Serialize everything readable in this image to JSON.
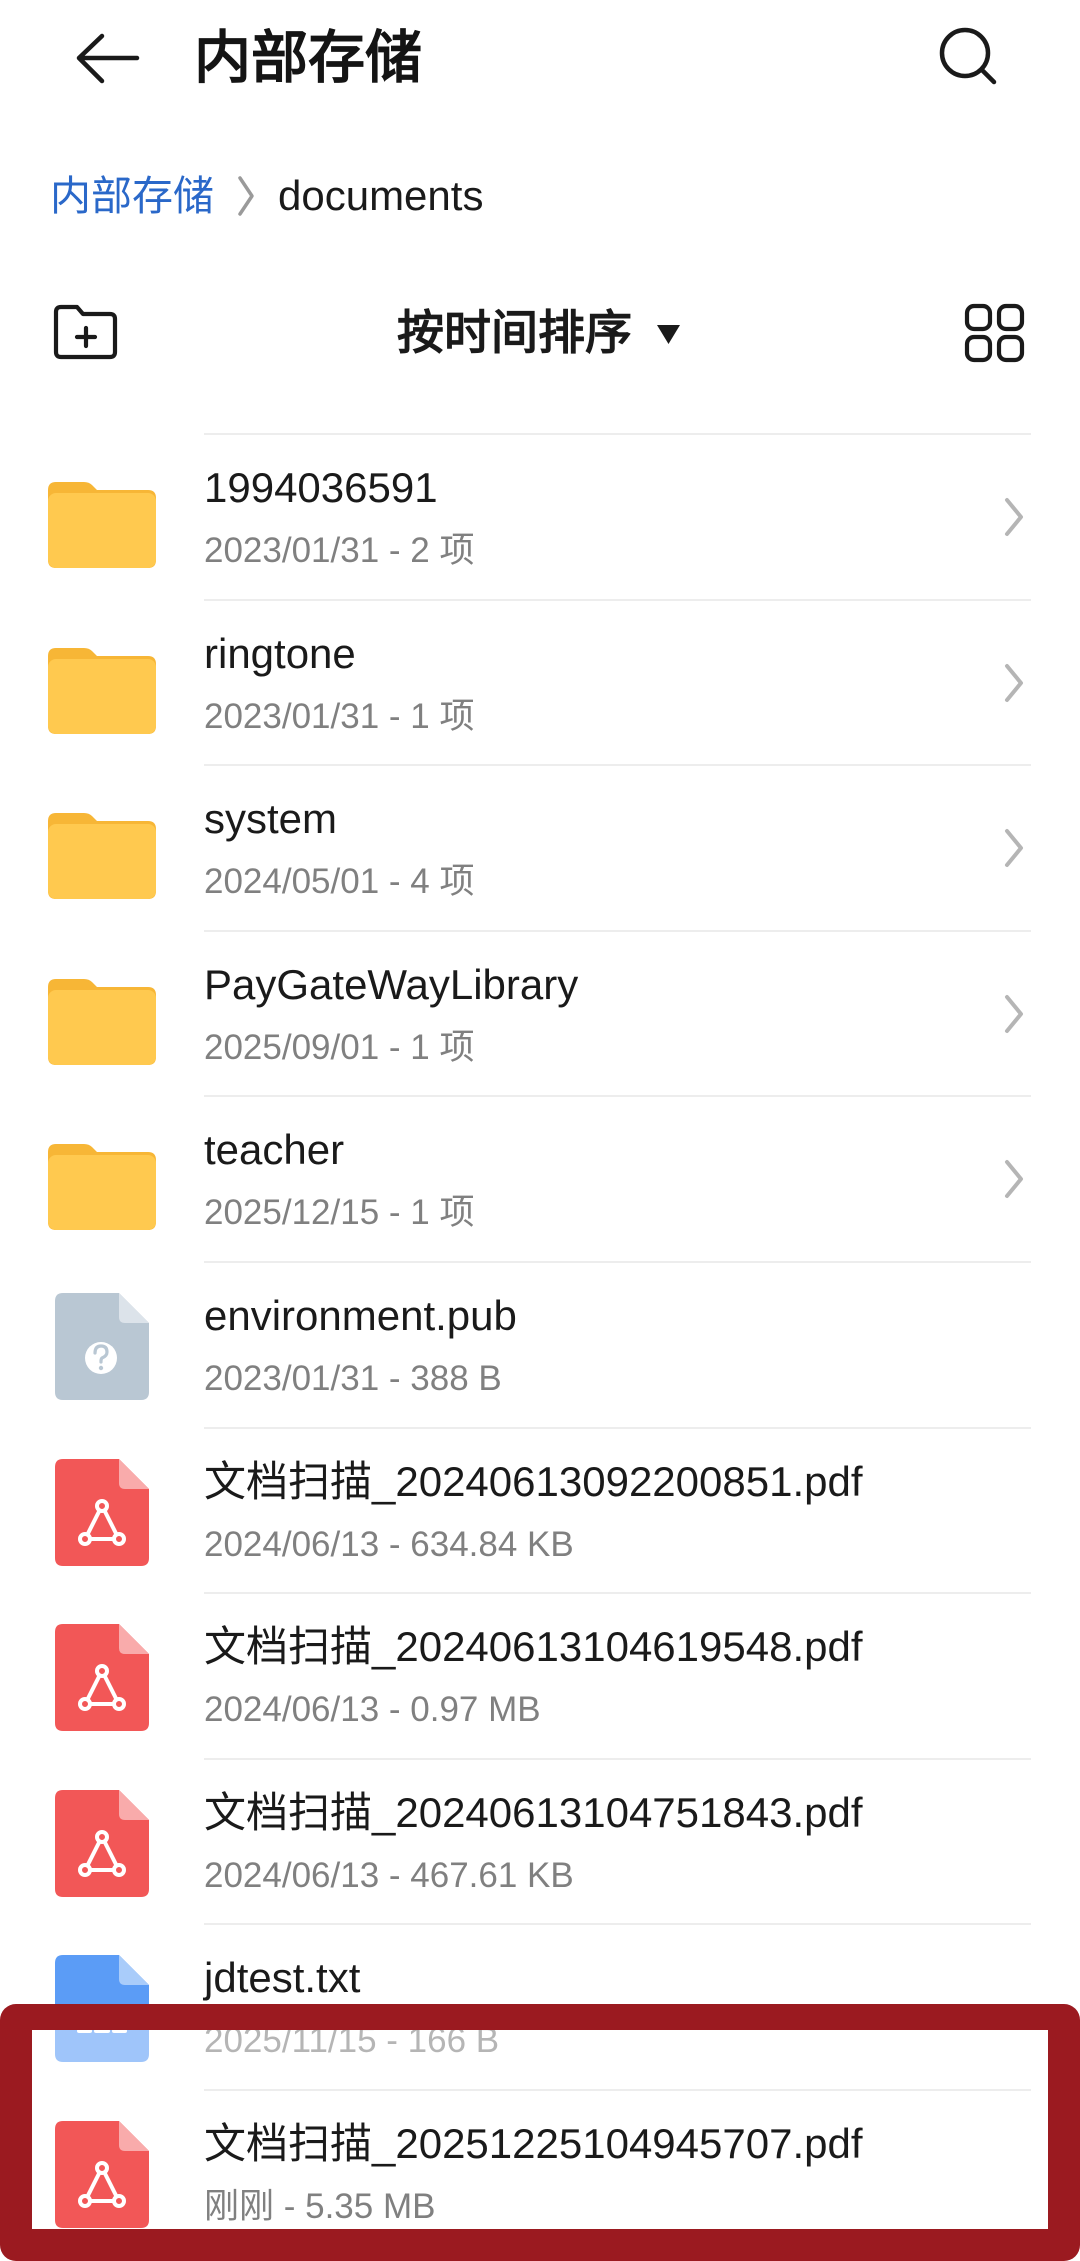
{
  "header": {
    "title": "内部存储",
    "back_icon": "back-arrow-icon",
    "search_icon": "search-icon"
  },
  "breadcrumb": {
    "root": "内部存储",
    "separator_icon": "chevron-right-icon",
    "current": "documents"
  },
  "toolbar": {
    "new_folder_icon": "new-folder-icon",
    "sort_label": "按时间排序",
    "sort_icon": "caret-down-icon",
    "view_icon": "grid-view-icon"
  },
  "files": [
    {
      "icon": "folder-icon",
      "name": "1994036591",
      "meta": "2023/01/31 - 2 项"
    },
    {
      "icon": "folder-icon",
      "name": "ringtone",
      "meta": "2023/01/31 - 1 项"
    },
    {
      "icon": "folder-icon",
      "name": "system",
      "meta": "2024/05/01 - 4 项"
    },
    {
      "icon": "folder-icon",
      "name": "PayGateWayLibrary",
      "meta": "2025/09/01 - 1 项"
    },
    {
      "icon": "folder-icon",
      "name": "teacher",
      "meta": "2025/12/15 - 1 项"
    },
    {
      "icon": "unknown-file-icon",
      "name": "environment.pub",
      "meta": "2023/01/31 - 388 B"
    },
    {
      "icon": "pdf-file-icon",
      "name": "文档扫描_20240613092200851.pdf",
      "meta": "2024/06/13 - 634.84 KB"
    },
    {
      "icon": "pdf-file-icon",
      "name": "文档扫描_20240613104619548.pdf",
      "meta": "2024/06/13 - 0.97 MB"
    },
    {
      "icon": "pdf-file-icon",
      "name": "文档扫描_20240613104751843.pdf",
      "meta": "2024/06/13 - 467.61 KB"
    },
    {
      "icon": "text-file-icon",
      "name": "jdtest.txt",
      "meta": "2025/11/15 - 166 B"
    },
    {
      "icon": "pdf-file-icon",
      "name": "文档扫描_20251225104945707.pdf",
      "meta": "刚刚 - 5.35 MB",
      "highlighted": true
    }
  ],
  "colors": {
    "accent": "#2A68C9",
    "folder": "#FFC94F",
    "folder_tab": "#F7B636",
    "pdf": "#F25757",
    "pdf_fold": "#F9ABAB",
    "txt": "#5B9CF6",
    "txt_fold": "#A9CCFA",
    "unknown": "#B9C7D3",
    "unknown_fold": "#DCE3EA",
    "annotation_frame": "#9B1A20"
  }
}
